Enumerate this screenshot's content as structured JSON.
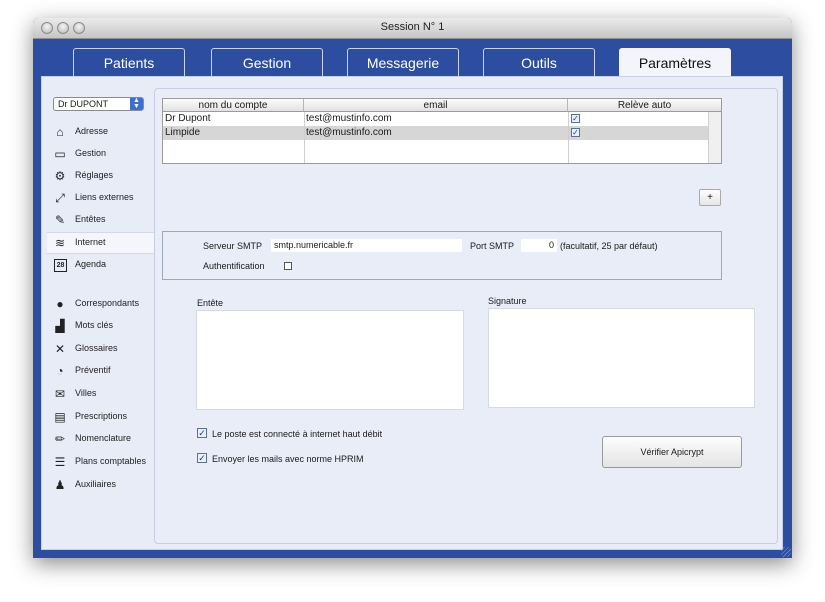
{
  "window": {
    "title": "Session N° 1"
  },
  "tabs": [
    {
      "label": "Patients",
      "active": false
    },
    {
      "label": "Gestion",
      "active": false
    },
    {
      "label": "Messagerie",
      "active": false
    },
    {
      "label": "Outils",
      "active": false
    },
    {
      "label": "Paramètres",
      "active": true
    }
  ],
  "user_select": {
    "value": "Dr DUPONT"
  },
  "sidebar": {
    "items": [
      {
        "label": "Adresse",
        "icon": "home-icon"
      },
      {
        "label": "Gestion",
        "icon": "inbox-icon"
      },
      {
        "label": "Réglages",
        "icon": "gear-icon"
      },
      {
        "label": "Liens externes",
        "icon": "expand-arrows-icon"
      },
      {
        "label": "Entêtes",
        "icon": "edit-icon"
      },
      {
        "label": "Internet",
        "icon": "wifi-icon",
        "active": true
      },
      {
        "label": "Agenda",
        "icon": "calendar-icon",
        "badge": "28"
      },
      {
        "label": "Correspondants",
        "icon": "person-icon"
      },
      {
        "label": "Mots clés",
        "icon": "bar-chart-icon"
      },
      {
        "label": "Glossaires",
        "icon": "tools-icon"
      },
      {
        "label": "Préventif",
        "icon": "clock-icon"
      },
      {
        "label": "Villes",
        "icon": "envelope-icon"
      },
      {
        "label": "Prescriptions",
        "icon": "document-icon"
      },
      {
        "label": "Nomenclature",
        "icon": "pencil-icon"
      },
      {
        "label": "Plans comptables",
        "icon": "list-icon"
      },
      {
        "label": "Auxiliaires",
        "icon": "people-icon"
      }
    ]
  },
  "accounts_table": {
    "columns": [
      "nom du compte",
      "email",
      "Relève auto"
    ],
    "rows": [
      {
        "name": "Dr Dupont",
        "email": "test@mustinfo.com",
        "auto": true
      },
      {
        "name": "Limpide",
        "email": "test@mustinfo.com",
        "auto": true
      }
    ],
    "add_button": "+"
  },
  "smtp": {
    "server_label": "Serveur SMTP",
    "server_value": "smtp.numericable.fr",
    "port_label": "Port SMTP",
    "port_value": "0",
    "port_hint": "(facultatif, 25 par défaut)",
    "auth_label": "Authentification",
    "auth_checked": false
  },
  "entete": {
    "label": "Entête"
  },
  "signature": {
    "label": "Signature"
  },
  "options": {
    "highspeed_label": "Le poste est connecté à internet haut débit",
    "highspeed_checked": true,
    "hprim_label": "Envoyer les mails avec norme HPRIM",
    "hprim_checked": true
  },
  "verify_button": "Vérifier Apicrypt",
  "colors": {
    "frame": "#2d4ea0",
    "panel": "#e8edf7",
    "check": "#1b3d9c"
  }
}
